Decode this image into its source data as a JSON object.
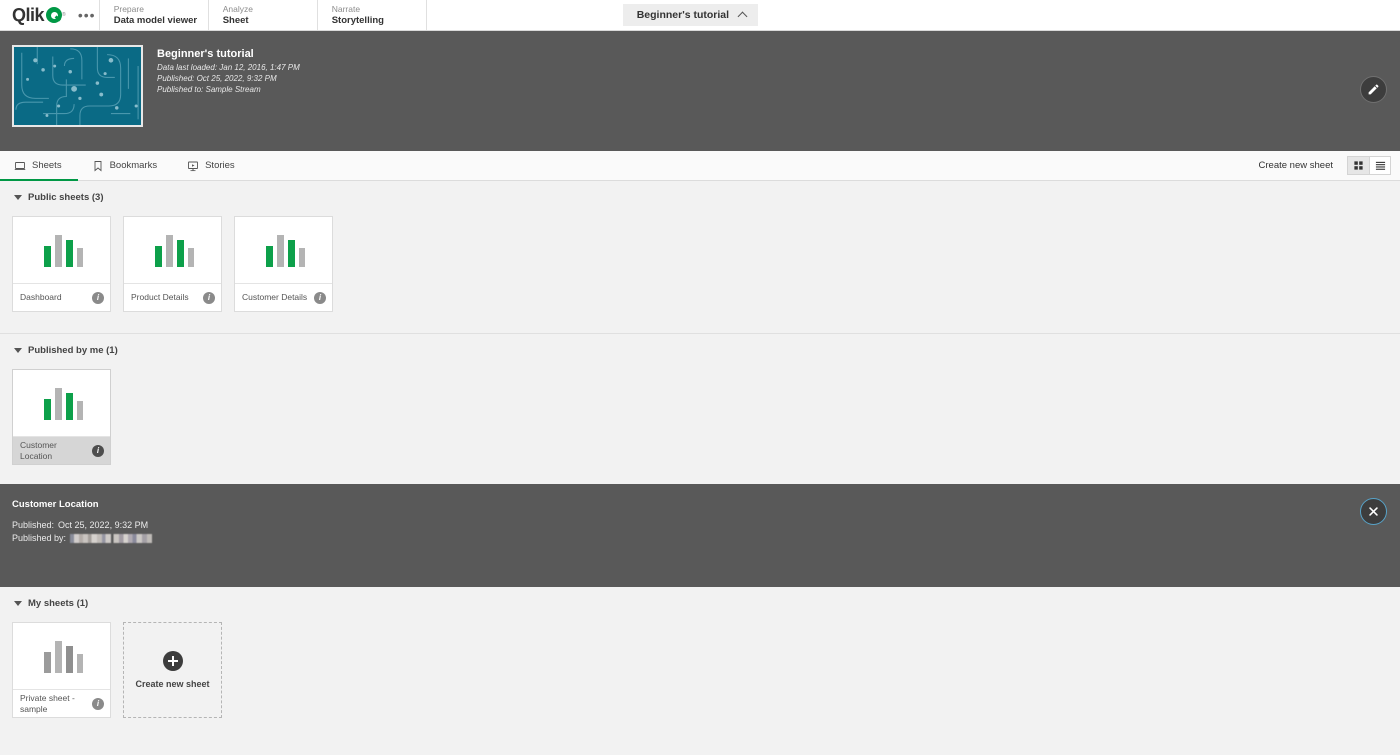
{
  "topnav": {
    "logo_text": "Qlik",
    "logo_trademark": "®",
    "overflow_label": "•••",
    "items": [
      {
        "top": "Prepare",
        "bottom": "Data model viewer"
      },
      {
        "top": "Analyze",
        "bottom": "Sheet"
      },
      {
        "top": "Narrate",
        "bottom": "Storytelling"
      }
    ],
    "app_pill_label": "Beginner's tutorial"
  },
  "app_header": {
    "title": "Beginner's tutorial",
    "meta": [
      "Data last loaded: Jan 12, 2016, 1:47 PM",
      "Published: Oct 25, 2022, 9:32 PM",
      "Published to: Sample Stream"
    ],
    "edit_button_label": "Edit app"
  },
  "tabs": [
    {
      "label": "Sheets",
      "icon": "sheet-icon",
      "active": true
    },
    {
      "label": "Bookmarks",
      "icon": "bookmark-icon",
      "active": false
    },
    {
      "label": "Stories",
      "icon": "story-icon",
      "active": false
    }
  ],
  "toolbar": {
    "create_new_sheet": "Create new sheet",
    "grid_view_label": "Grid view",
    "list_view_label": "List view",
    "active_view": "grid"
  },
  "sections": [
    {
      "title": "Public sheets (3)",
      "cards": [
        {
          "name": "Dashboard",
          "published": true,
          "selected": false
        },
        {
          "name": "Product Details",
          "published": true,
          "selected": false
        },
        {
          "name": "Customer Details",
          "published": true,
          "selected": false
        }
      ]
    },
    {
      "title": "Published by me (1)",
      "cards": [
        {
          "name": "Customer Location",
          "published": true,
          "selected": true
        }
      ]
    },
    {
      "title": "My sheets (1)",
      "cards": [
        {
          "name": "Private sheet - sample",
          "published": false,
          "selected": false
        }
      ],
      "has_create_card": true,
      "create_card_label": "Create new\nsheet"
    }
  ],
  "detail_panel": {
    "title": "Customer Location",
    "published_label": "Published:",
    "published_value": "Oct 25, 2022, 9:32 PM",
    "published_by_label": "Published by:",
    "published_by_value_redacted": true,
    "close_label": "Close"
  },
  "colors": {
    "accent_green": "#009845",
    "header_gray": "#595959",
    "page_background": "#f2f2f2",
    "thumbnail_teal": "#0a6a85",
    "close_ring_blue": "#57a3c9",
    "bar_green": "#0da04a",
    "bar_gray": "#b4b4b4"
  }
}
